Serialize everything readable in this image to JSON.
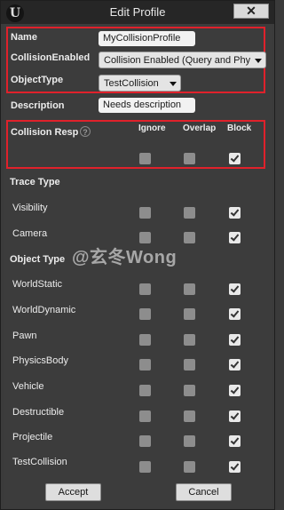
{
  "window": {
    "title": "Edit Profile",
    "close_glyph": "✕",
    "logo_glyph": "U"
  },
  "fields": {
    "name_label": "Name",
    "name_value": "MyCollisionProfile",
    "collision_enabled_label": "CollisionEnabled",
    "collision_enabled_value": "Collision Enabled (Query and Phy",
    "object_type_label": "ObjectType",
    "object_type_value": "TestCollision",
    "description_label": "Description",
    "description_value": "Needs description"
  },
  "collision_response": {
    "label": "Collision Resp",
    "help_glyph": "?",
    "columns": [
      "Ignore",
      "Overlap",
      "Block"
    ],
    "all_row": [
      "off",
      "off",
      "on"
    ]
  },
  "trace_type": {
    "heading": "Trace Type",
    "rows": [
      {
        "name": "Visibility",
        "checks": [
          "off",
          "off",
          "on"
        ]
      },
      {
        "name": "Camera",
        "checks": [
          "off",
          "off",
          "on"
        ]
      }
    ]
  },
  "object_type": {
    "heading": "Object Type",
    "rows": [
      {
        "name": "WorldStatic",
        "checks": [
          "off",
          "off",
          "on"
        ]
      },
      {
        "name": "WorldDynamic",
        "checks": [
          "off",
          "off",
          "on"
        ]
      },
      {
        "name": "Pawn",
        "checks": [
          "off",
          "off",
          "on"
        ]
      },
      {
        "name": "PhysicsBody",
        "checks": [
          "off",
          "off",
          "on"
        ]
      },
      {
        "name": "Vehicle",
        "checks": [
          "off",
          "off",
          "on"
        ]
      },
      {
        "name": "Destructible",
        "checks": [
          "off",
          "off",
          "on"
        ]
      },
      {
        "name": "Projectile",
        "checks": [
          "off",
          "off",
          "on"
        ]
      },
      {
        "name": "TestCollision",
        "checks": [
          "off",
          "off",
          "on"
        ]
      }
    ]
  },
  "watermark": "@玄冬Wong",
  "buttons": {
    "accept": "Accept",
    "cancel": "Cancel"
  },
  "colors": {
    "highlight_box": "#e0212b",
    "panel": "#3c3c3c",
    "titlebar": "#262626"
  }
}
